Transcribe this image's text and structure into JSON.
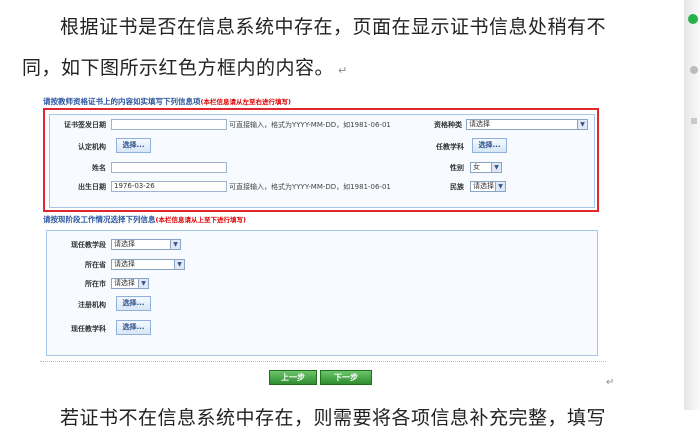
{
  "doc": {
    "para1": "根据证书是否在信息系统中存在，页面在显示证书信息处稍有不",
    "para2": "同，如下图所示红色方框内的内容。",
    "para3": "若证书不在信息系统中存在，则需要将各项信息补充完整，填写",
    "mark": "↵"
  },
  "form": {
    "section1_title": "请按教师资格证书上的内容如实填写下列信息项",
    "section1_note": "(本栏信息请从左至右进行填写)",
    "section2_title": "请按现阶段工作情况选择下列信息",
    "section2_note": "(本栏信息请从上至下进行填写)",
    "cert_date_label": "证书签发日期",
    "cert_date_value": "",
    "date_hint": "可直接输入，格式为YYYY-MM-DD，如1981-06-01",
    "qual_type_label": "资格种类",
    "qual_type_value": "请选择",
    "cert_org_label": "认定机构",
    "pick_label": "选择...",
    "subject_label": "任教学科",
    "name_label": "姓名",
    "name_value": "",
    "gender_label": "性别",
    "gender_value": "女",
    "birth_label": "出生日期",
    "birth_value": "1976-03-26",
    "ethnic_label": "民族",
    "ethnic_value": "请选择",
    "stage_label": "现任教学段",
    "stage_value": "请选择",
    "province_label": "所在省",
    "province_value": "请选择",
    "city_label": "所在市",
    "city_value": "请选择",
    "reg_org_label": "注册机构",
    "cur_subject_label": "现任教学科",
    "prev_button": "上一步",
    "next_button": "下一步"
  },
  "colors": {
    "highlight_border": "#e0262e",
    "title_blue": "#2b57a0",
    "button_green": "#2f8e2f"
  },
  "icons": {
    "dropdown": "chevron-down-icon",
    "sidebar_badge": "status-dot-icon"
  }
}
